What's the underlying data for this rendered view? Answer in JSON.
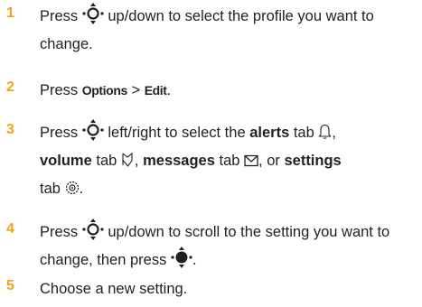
{
  "steps": [
    {
      "number": "1",
      "parts": [
        "Press",
        "up/down to select the profile you want to change."
      ]
    },
    {
      "number": "2",
      "parts": [
        "Press",
        "Options",
        ">",
        "Edit",
        "."
      ]
    },
    {
      "number": "3",
      "parts": [
        "Press",
        "left/right to select the",
        "alerts",
        "tab",
        ",",
        "volume",
        "tab",
        ",",
        "messages",
        "tab",
        ", or",
        "settings",
        "tab",
        "."
      ]
    },
    {
      "number": "4",
      "parts": [
        "Press",
        "up/down to scroll to the setting you want to change, then press",
        "."
      ]
    },
    {
      "number": "5",
      "parts": [
        "Choose a new setting."
      ]
    }
  ],
  "icons": [
    "nav-key-icon",
    "nav-center-select-icon",
    "bell-alert-icon",
    "volume-icon",
    "envelope-icon",
    "settings-gear-icon"
  ],
  "colors": {
    "step_number": "#f5a11c",
    "text": "#231f20",
    "background": "#ffffff"
  }
}
